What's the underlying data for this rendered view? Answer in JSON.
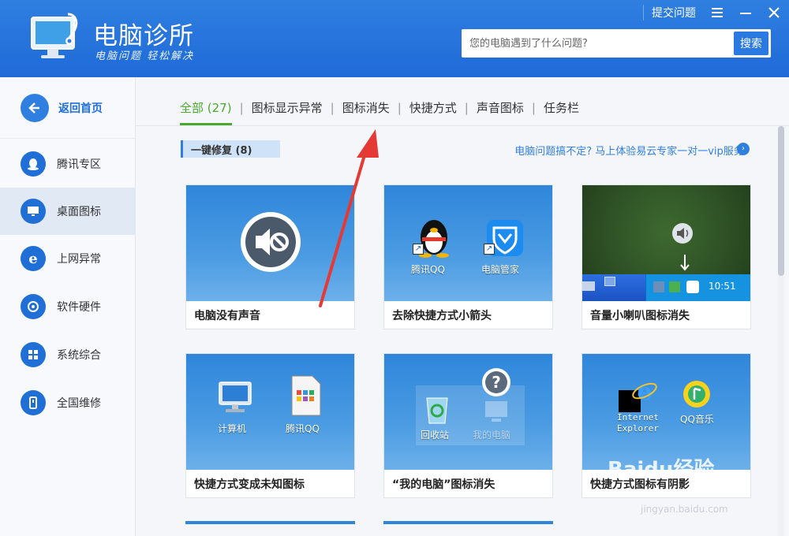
{
  "app": {
    "title": "电脑诊所",
    "slogan": "电脑问题 轻松解决",
    "feedback_label": "提交问题"
  },
  "search": {
    "placeholder": "您的电脑遇到了什么问题?",
    "button_label": "搜索"
  },
  "sidebar": {
    "home_label": "返回首页",
    "items": [
      {
        "label": "腾讯专区",
        "icon": "penguin-icon"
      },
      {
        "label": "桌面图标",
        "icon": "monitor-icon",
        "active": true
      },
      {
        "label": "上网异常",
        "icon": "ie-icon"
      },
      {
        "label": "软件硬件",
        "icon": "puzzle-icon"
      },
      {
        "label": "系统综合",
        "icon": "windows-icon"
      },
      {
        "label": "全国维修",
        "icon": "phone-icon"
      }
    ]
  },
  "tabs": [
    {
      "label": "全部 (27)",
      "active": true
    },
    {
      "label": "图标显示异常"
    },
    {
      "label": "图标消失"
    },
    {
      "label": "快捷方式"
    },
    {
      "label": "声音图标"
    },
    {
      "label": "任务栏"
    }
  ],
  "section": {
    "title": "一键修复 (8)",
    "promo": "电脑问题搞不定? 马上体验易云专家一对一vip服务!"
  },
  "cards": [
    {
      "title": "电脑没有声音",
      "image_icon": "speaker-mute-icon"
    },
    {
      "title": "去除快捷方式小箭头",
      "labels": [
        "腾讯QQ",
        "电脑管家"
      ]
    },
    {
      "title": "音量小喇叭图标消失",
      "tray_time": "10:51"
    },
    {
      "title": "快捷方式变成未知图标",
      "labels": [
        "计算机",
        "腾讯QQ"
      ]
    },
    {
      "title": "“我的电脑”图标消失",
      "labels": [
        "回收站",
        "我的电脑"
      ]
    },
    {
      "title": "快捷方式图标有阴影",
      "labels": [
        "Internet Explorer",
        "QQ音乐"
      ]
    }
  ],
  "watermark": {
    "text": "Baidu经验",
    "url": "jingyan.baidu.com"
  },
  "colors": {
    "header_blue": "#2f7fe0",
    "active_tab_green": "#4aa82c",
    "annotation_red": "#e53935"
  }
}
